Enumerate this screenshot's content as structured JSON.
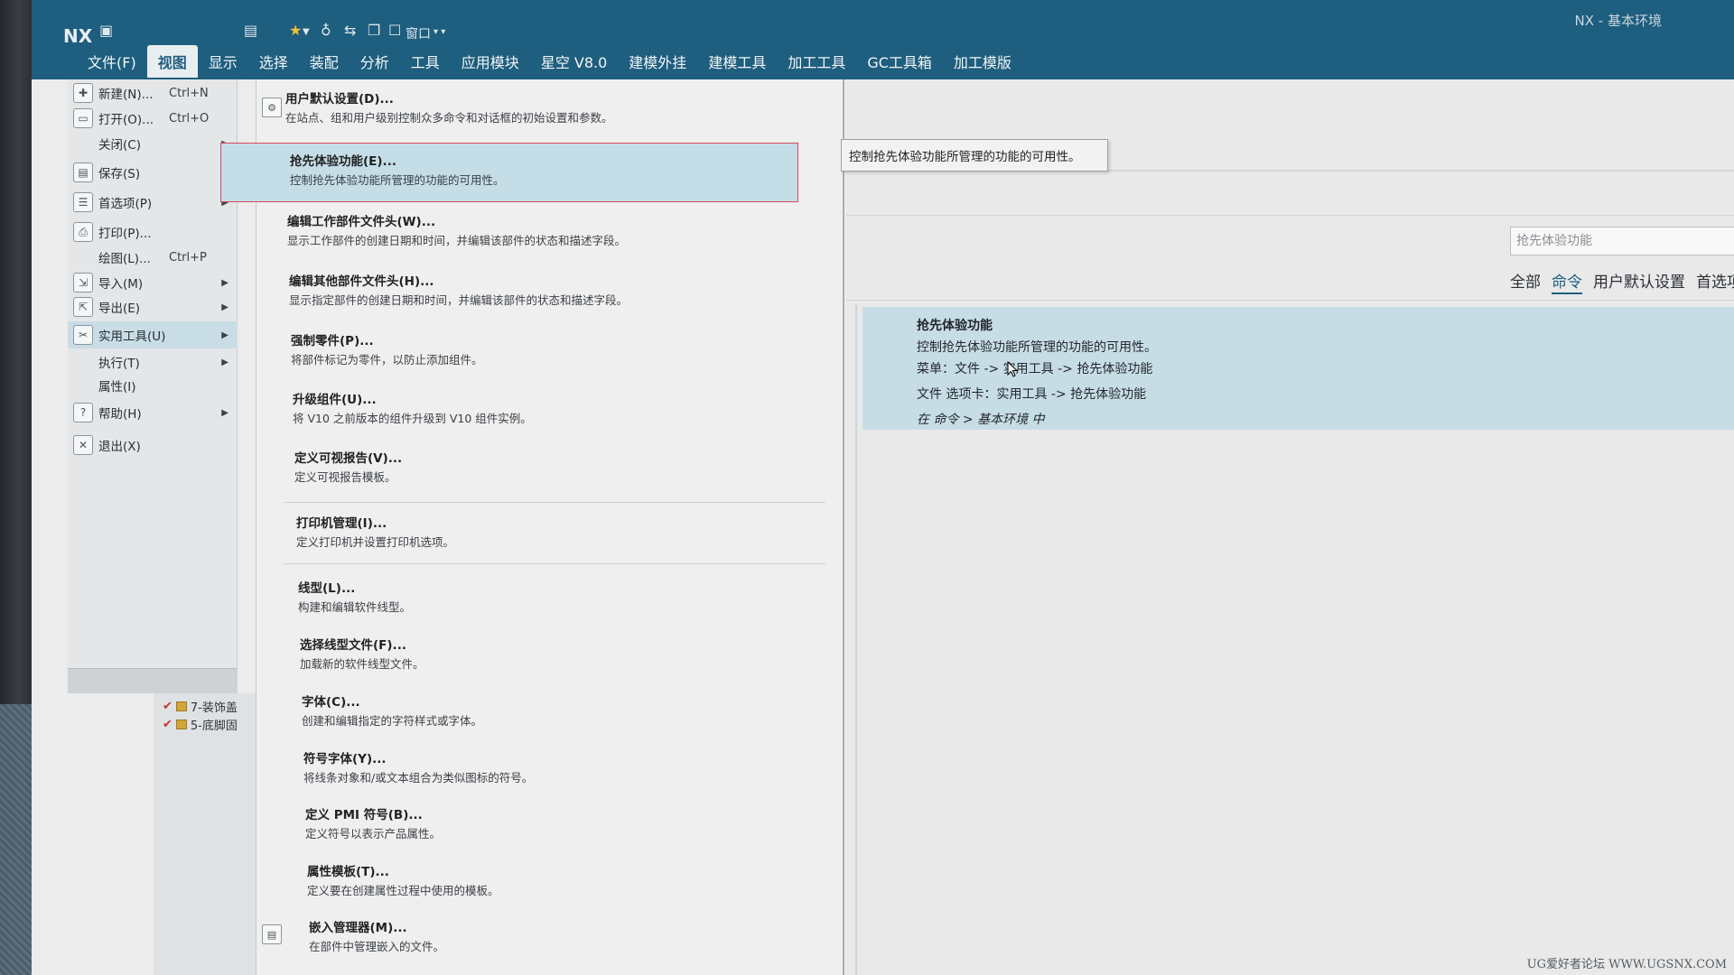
{
  "app": {
    "logo": "NX",
    "window_title": "NX - 基本环境",
    "quick_access": {
      "window_menu": "窗口"
    }
  },
  "ribbon_tabs": [
    "文件(F)",
    "视图",
    "显示",
    "选择",
    "装配",
    "分析",
    "工具",
    "应用模块",
    "星空 V8.0",
    "建模外挂",
    "建模工具",
    "加工工具",
    "GC工具箱",
    "加工模版"
  ],
  "ribbon_active_index": 1,
  "file_menu": [
    {
      "label": "新建(N)...",
      "shortcut": "Ctrl+N",
      "icon": "new-file-icon",
      "submenu": false
    },
    {
      "label": "打开(O)...",
      "shortcut": "Ctrl+O",
      "icon": "open-folder-icon",
      "submenu": false
    },
    {
      "label": "关闭(C)",
      "shortcut": "",
      "icon": "",
      "submenu": true
    },
    {
      "label": "保存(S)",
      "shortcut": "",
      "icon": "save-icon",
      "submenu": true
    },
    {
      "label": "首选项(P)",
      "shortcut": "",
      "icon": "preferences-icon",
      "submenu": true
    },
    {
      "label": "打印(P)...",
      "shortcut": "",
      "icon": "print-icon",
      "submenu": false
    },
    {
      "label": "绘图(L)...",
      "shortcut": "Ctrl+P",
      "icon": "",
      "submenu": false
    },
    {
      "label": "导入(M)",
      "shortcut": "",
      "icon": "import-icon",
      "submenu": true
    },
    {
      "label": "导出(E)",
      "shortcut": "",
      "icon": "export-icon",
      "submenu": true
    },
    {
      "label": "实用工具(U)",
      "shortcut": "",
      "icon": "utilities-icon",
      "submenu": true
    },
    {
      "label": "执行(T)",
      "shortcut": "",
      "icon": "",
      "submenu": true
    },
    {
      "label": "属性(I)",
      "shortcut": "",
      "icon": "",
      "submenu": false
    },
    {
      "label": "帮助(H)",
      "shortcut": "",
      "icon": "help-icon",
      "submenu": true
    },
    {
      "label": "退出(X)",
      "shortcut": "",
      "icon": "exit-icon",
      "submenu": false
    }
  ],
  "file_menu_active_index": 9,
  "tree_items": [
    "7-装饰盖",
    "5-底脚固"
  ],
  "submenu": [
    {
      "title": "用户默认设置(D)...",
      "desc": "在站点、组和用户级别控制众多命令和对话框的初始设置和参数。"
    },
    {
      "title": "抢先体验功能(E)...",
      "desc": "控制抢先体验功能所管理的功能的可用性。"
    },
    {
      "title": "编辑工作部件文件头(W)...",
      "desc": "显示工作部件的创建日期和时间，并编辑该部件的状态和描述字段。"
    },
    {
      "title": "编辑其他部件文件头(H)...",
      "desc": "显示指定部件的创建日期和时间，并编辑该部件的状态和描述字段。"
    },
    {
      "title": "强制零件(P)...",
      "desc": "将部件标记为零件，以防止添加组件。"
    },
    {
      "title": "升级组件(U)...",
      "desc": "将 V10 之前版本的组件升级到 V10 组件实例。"
    },
    {
      "title": "定义可视报告(V)...",
      "desc": "定义可视报告模板。"
    },
    {
      "title": "打印机管理(I)...",
      "desc": "定义打印机并设置打印机选项。"
    },
    {
      "title": "线型(L)...",
      "desc": "构建和编辑软件线型。"
    },
    {
      "title": "选择线型文件(F)...",
      "desc": "加载新的软件线型文件。"
    },
    {
      "title": "字体(C)...",
      "desc": "创建和编辑指定的字符样式或字体。"
    },
    {
      "title": "符号字体(Y)...",
      "desc": "将线条对象和/或文本组合为类似图标的符号。"
    },
    {
      "title": "定义 PMI 符号(B)...",
      "desc": "定义符号以表示产品属性。"
    },
    {
      "title": "属性模板(T)...",
      "desc": "定义要在创建属性过程中使用的模板。"
    },
    {
      "title": "嵌入管理器(M)...",
      "desc": "在部件中管理嵌入的文件。"
    }
  ],
  "submenu_highlight_index": 1,
  "tooltip": "控制抢先体验功能所管理的功能的可用性。",
  "command_finder": {
    "search_value": "抢先体验功能",
    "filters": [
      "全部",
      "命令",
      "用户默认设置",
      "首选项"
    ],
    "active_filter_index": 1,
    "result": {
      "title": "抢先体验功能",
      "desc": "控制抢先体验功能所管理的功能的可用性。",
      "menu_path": "菜单：文件 -> 实用工具 -> 抢先体验功能",
      "tab_path": "文件 选项卡：实用工具 -> 抢先体验功能",
      "location": "在 命令 > 基本环境 中"
    }
  },
  "watermark": "UG爱好者论坛 WWW.UGSNX.COM",
  "colors": {
    "titlebar": "#1e5e7e",
    "highlight": "#c4dde7",
    "highlight_border": "#d44a5e",
    "result_bg": "#c7dde6"
  }
}
